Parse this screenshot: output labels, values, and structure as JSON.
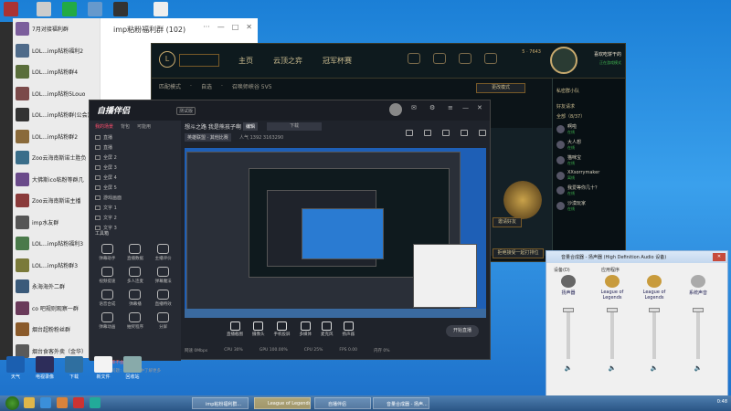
{
  "chat": {
    "group_title": "imp粘粉福利群 (102)",
    "window_controls": [
      "···",
      "—",
      "□",
      "✕"
    ],
    "items": [
      {
        "name": "7月对接福利群",
        "preview": "",
        "color": "#7c5e9c"
      },
      {
        "name": "LOL...imp粘粉福利2",
        "preview": "",
        "color": "#4f6b8a"
      },
      {
        "name": "LOL...imp粘粉群4",
        "preview": "",
        "color": "#5a6e3b"
      },
      {
        "name": "LOL...imp粘粉5Louo",
        "preview": "",
        "color": "#7b4a4a"
      },
      {
        "name": "LOL...imp粘粉群(公会)",
        "preview": "",
        "color": "#333"
      },
      {
        "name": "LOL...imp粘粉群2",
        "preview": "",
        "color": "#8a6a3a"
      },
      {
        "name": "Zoo云海南斯诺士胜负",
        "preview": "",
        "color": "#3a6e8a"
      },
      {
        "name": "大佛斯ico粘粉等群几",
        "preview": "",
        "color": "#6a4a8a"
      },
      {
        "name": "Zoo云海南斯诺主播",
        "preview": "",
        "color": "#8a3a3a"
      },
      {
        "name": "imp水友群",
        "preview": "",
        "color": "#555"
      },
      {
        "name": "LOL...imp粘粉福利3",
        "preview": "",
        "color": "#4a7a4a"
      },
      {
        "name": "LOL...imp粘粉群3",
        "preview": "",
        "color": "#7a7a3a"
      },
      {
        "name": "永海海外二群",
        "preview": "",
        "color": "#3a5a7a"
      },
      {
        "name": "co 吧规则观察一群",
        "preview": "",
        "color": "#6a3a5a"
      },
      {
        "name": "烟台超粉粉丝群",
        "preview": "",
        "color": "#8a5a2a"
      },
      {
        "name": "烟台食客外卖（金华）",
        "preview": "",
        "color": "#5a5a5a"
      }
    ]
  },
  "lol": {
    "nav": [
      "主页",
      "云顶之弈",
      "冠军杯赛"
    ],
    "sub": [
      "匹配模式",
      "·",
      "自选",
      "·",
      "召唤师峡谷 5V5"
    ],
    "side_title": "私密群小队",
    "side_rows": [
      "好友请求",
      "全部（8/37）"
    ],
    "friends": [
      {
        "name": "啊啦",
        "status": "在线"
      },
      {
        "name": "大人想",
        "status": "在线"
      },
      {
        "name": "猫咪宝",
        "status": "在线"
      },
      {
        "name": "XXsorrymaker",
        "status": "离线"
      },
      {
        "name": "我爱等你几十？",
        "status": "在线"
      },
      {
        "name": "沙漠玩家",
        "status": "在线"
      }
    ],
    "btn_change_mode": "更改模式",
    "btn_invite": "邀请好友",
    "btn_search": "拒绝接受一起打排位",
    "gold": "5",
    "rp": "7643",
    "profile_name": "喜欢吃饼干的",
    "profile_status": "正在游戏模式"
  },
  "zb": {
    "app_name": "自播伴侣",
    "badge": "测试版",
    "tabs": [
      "我的场景",
      "背包",
      "可能用"
    ],
    "scenes": [
      "直播",
      "直播",
      "全屏 2",
      "全屏 3",
      "全屏 4",
      "全屏 5",
      "游戏画面",
      "文字 1",
      "文字 2",
      "文字 3"
    ],
    "tools_title": "工具箱",
    "tools": [
      "弹幕助手",
      "直播数据",
      "主播评价",
      "视频提速",
      "多人连麦",
      "弹幕魔法",
      "语音合成",
      "弹幕播",
      "直播特效",
      "弹幕动画",
      "抽奖程序",
      "分屏"
    ],
    "note": "直播设置问题：在直播间中了解更多",
    "note2": "让推流速率不会造成卡顿",
    "title": "想斗之路 我是熊孩子啊",
    "edit": "编辑",
    "download": "下载",
    "category": "英雄联盟 · 其他比赛",
    "stats": "人气 1392   3163290",
    "actions": [
      "直播截图",
      "摄像头",
      "手机投屏",
      "多媒体",
      "麦克风",
      "扬声器"
    ],
    "go_live": "开始直播",
    "status": [
      "网速 0Mbps",
      "CPU 30%",
      "GPU 100.00%",
      "CPU 25%",
      "FPS 0.00",
      "内存 0%"
    ]
  },
  "mixer": {
    "title": "音量合成器 - 扬声器 (High Definition Audio 设备)",
    "device_label": "设备(D)",
    "apps_label": "应用程序",
    "cols": [
      {
        "name": "扬声器",
        "level": 0.0
      },
      {
        "name": "League of Legends",
        "level": 0.0
      },
      {
        "name": "League of Legends",
        "level": 0.0
      },
      {
        "name": "系统声音",
        "level": 0.0
      }
    ]
  },
  "desktop": {
    "icons": [
      "天气",
      "电视录像",
      "下载",
      "新文件",
      "回收站"
    ]
  },
  "taskbar": {
    "tasks": [
      "imp粘粉福利群...",
      "League of Legends",
      "自播伴侣",
      "音量合成器 - 扬声..."
    ],
    "time": "0:48"
  }
}
